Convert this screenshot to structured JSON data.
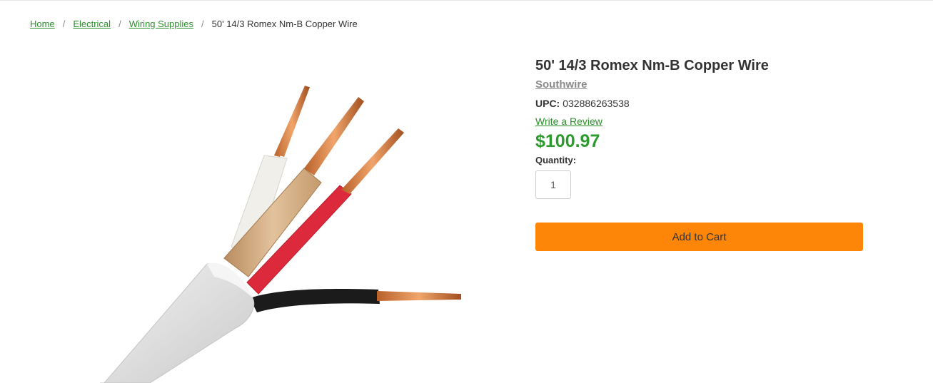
{
  "breadcrumb": {
    "items": [
      {
        "label": "Home"
      },
      {
        "label": "Electrical"
      },
      {
        "label": "Wiring Supplies"
      }
    ],
    "separator": "/",
    "current": "50' 14/3 Romex Nm-B Copper Wire"
  },
  "product": {
    "title": "50' 14/3 Romex Nm-B Copper Wire",
    "brand": "Southwire",
    "upc_label": "UPC:",
    "upc_value": "032886263538",
    "review_link": "Write a Review",
    "price": "$100.97",
    "quantity_label": "Quantity:",
    "quantity_value": "1",
    "add_to_cart_label": "Add to Cart",
    "image_icon": "romex-wire-image"
  },
  "colors": {
    "link_green": "#2c8f2c",
    "price_green": "#2c9a2c",
    "cart_orange": "#fd8608",
    "brand_gray": "#8a8a8a"
  }
}
